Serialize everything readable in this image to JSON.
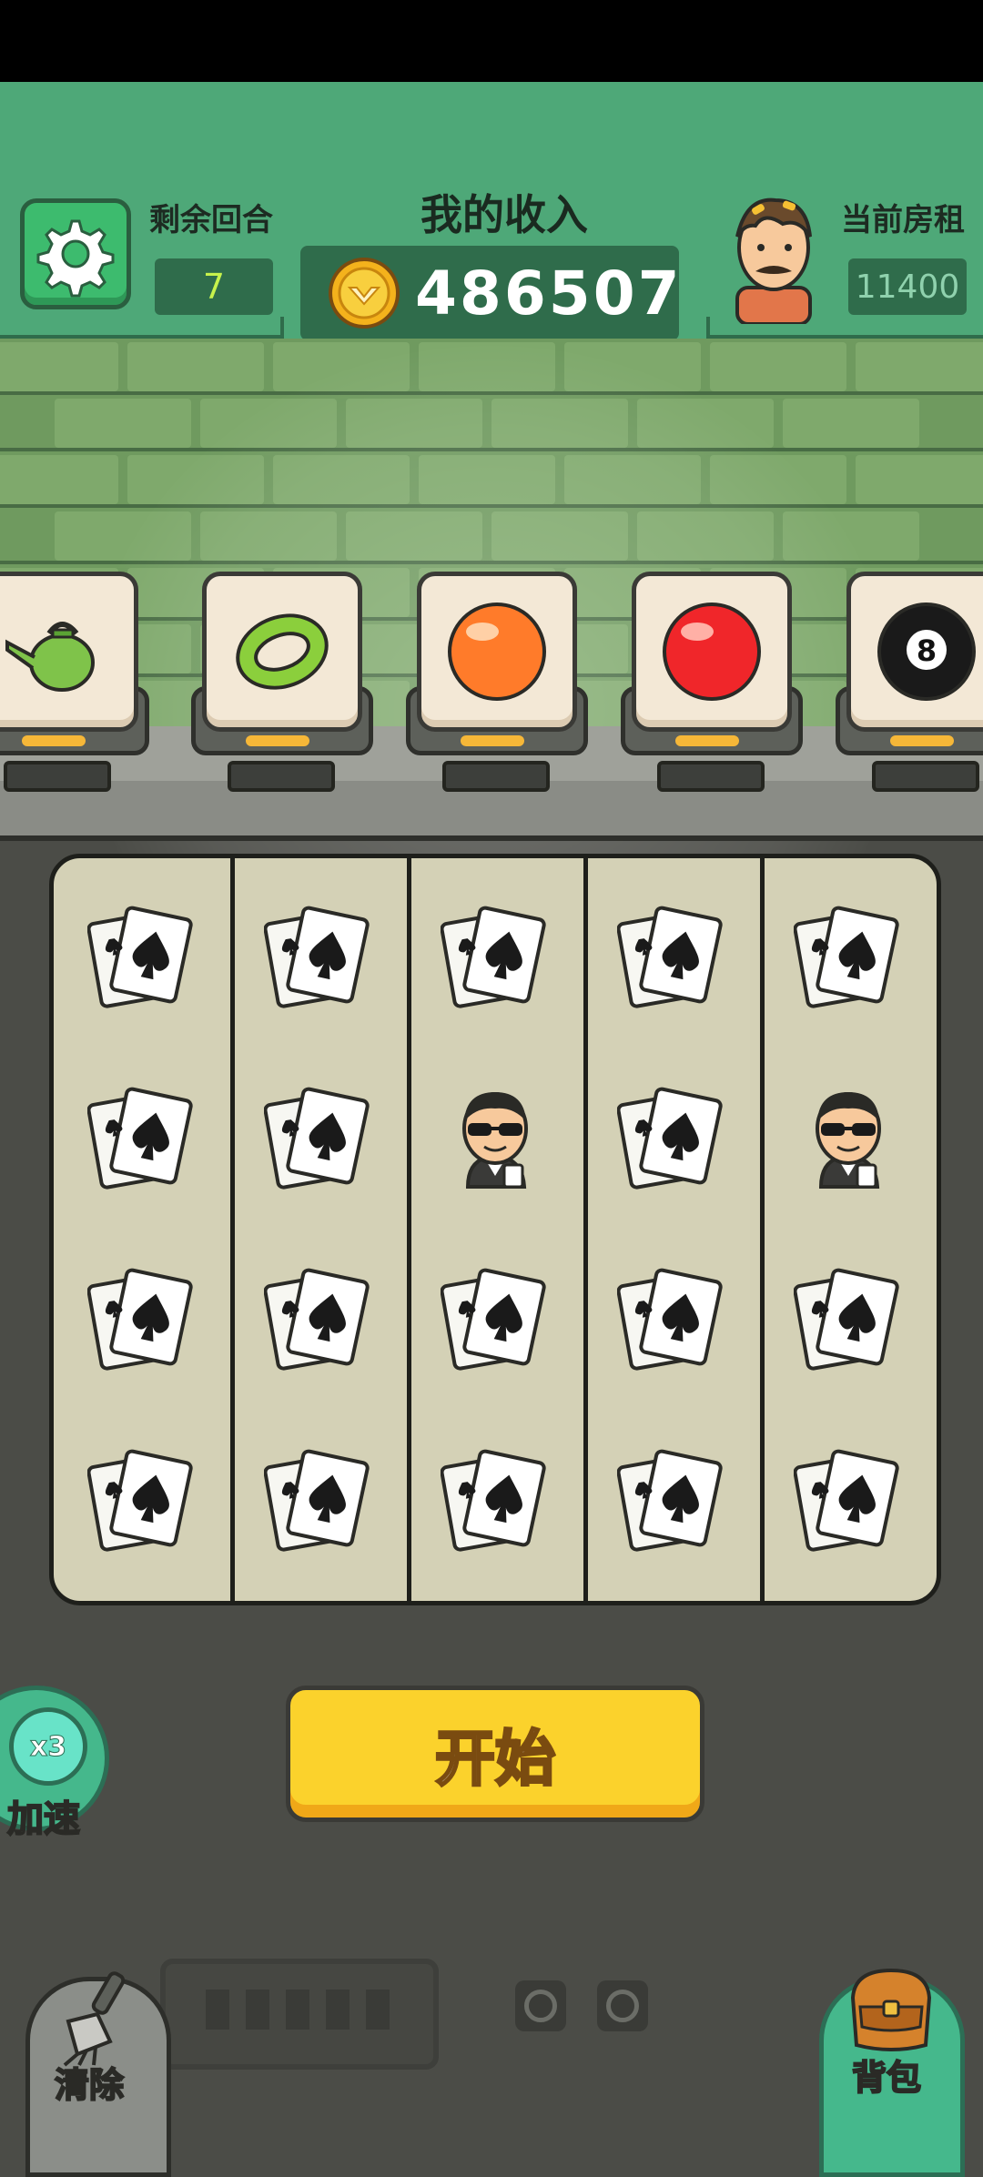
{
  "header": {
    "rounds_label": "剩余回合",
    "rounds_value": "7",
    "income_title": "我的收入",
    "income_value": "486507",
    "rent_label": "当前房租",
    "rent_value": "11400"
  },
  "items": [
    {
      "name": "watering-can-icon"
    },
    {
      "name": "green-ring-icon"
    },
    {
      "name": "orange-ball-icon"
    },
    {
      "name": "red-ball-icon"
    },
    {
      "name": "eight-ball-icon",
      "text": "8"
    }
  ],
  "board": {
    "rows": [
      [
        "cards",
        "cards",
        "cards",
        "cards",
        "cards"
      ],
      [
        "cards",
        "cards",
        "gambler",
        "cards",
        "gambler"
      ],
      [
        "cards",
        "cards",
        "cards",
        "cards",
        "cards"
      ],
      [
        "cards",
        "cards",
        "cards",
        "cards",
        "cards"
      ]
    ]
  },
  "controls": {
    "start_label": "开始",
    "speed_multiplier": "x3",
    "speed_label": "加速",
    "clear_label": "清除",
    "bag_label": "背包"
  },
  "colors": {
    "header_green": "#4ea878",
    "start_yellow": "#fbd22c",
    "rounds_text": "#c7f24c"
  }
}
